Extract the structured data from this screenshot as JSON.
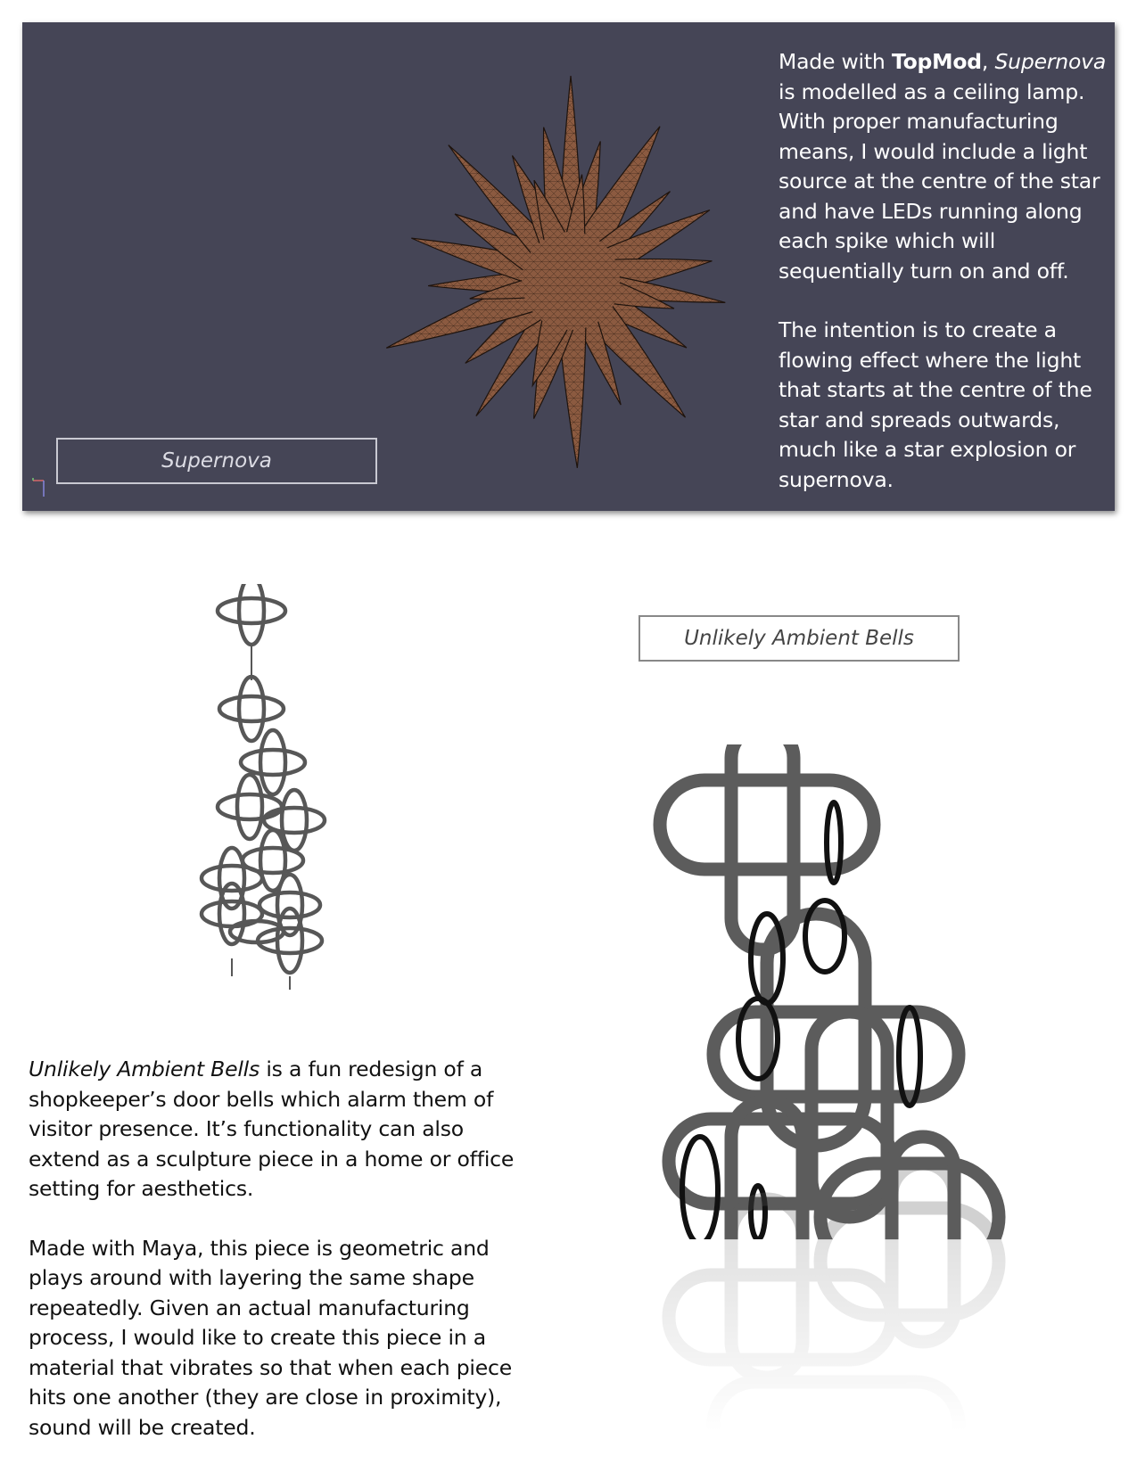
{
  "supernova": {
    "label": "Supernova",
    "para1": {
      "t1": "Made with ",
      "bold": "TopMod",
      "t2": ", ",
      "italic": "Supernova",
      "t3": " is modelled as a ceiling lamp. With proper manufacturing means, I would include a light source at the centre of the star and have LEDs running along each spike which will sequentially turn on and off."
    },
    "para2": "The intention is to create a flowing effect where the light that starts at the centre of the star and spreads outwards, much like a star explosion or supernova.",
    "colors": {
      "panel": "#454556",
      "star": "#8b5a40",
      "mesh": "#1a1a1a"
    }
  },
  "bells": {
    "label": "Unlikely Ambient Bells",
    "para1": {
      "italic": "Unlikely Ambient Bells",
      "t1": " is a fun redesign of a shopkeeper’s door bells which alarm them of visitor presence. It’s functionality can also extend as a sculpture piece in a home or office setting for aesthetics."
    },
    "para2": "Made with Maya, this piece is geometric and plays around with layering the same shape repeatedly. Given an actual manufacturing process, I would like to create this piece in a material that vibrates so that when each piece hits one another (they are close in proximity), sound will be created.",
    "colors": {
      "ring": "#555555",
      "ring_dark": "#111111"
    }
  }
}
